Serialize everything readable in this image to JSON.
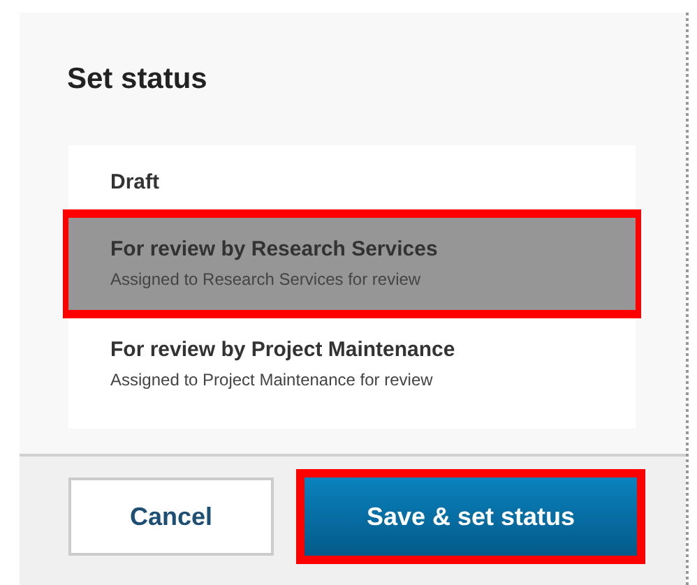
{
  "dialog": {
    "title": "Set status",
    "options": [
      {
        "label": "Draft",
        "selected": false,
        "highlighted": false
      },
      {
        "label": "For review by Research Services",
        "description": "Assigned to Research Services for review",
        "selected": true,
        "highlighted": true
      },
      {
        "label": "For review by Project Maintenance",
        "description": "Assigned to Project Maintenance for review",
        "selected": false,
        "highlighted": false
      }
    ],
    "buttons": [
      {
        "label": "Cancel",
        "kind": "secondary",
        "highlighted": false
      },
      {
        "label": "Save & set status",
        "kind": "primary",
        "highlighted": true
      }
    ]
  }
}
